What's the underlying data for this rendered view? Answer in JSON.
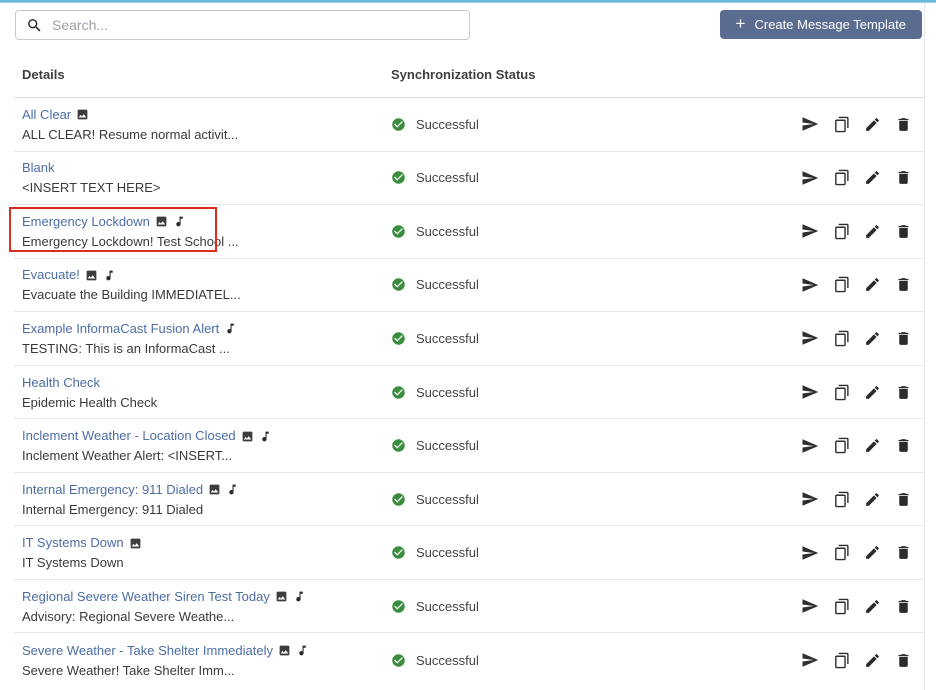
{
  "toolbar": {
    "search_placeholder": "Search...",
    "plus_glyph": "+",
    "create_button_label": "Create Message Template"
  },
  "table": {
    "headers": {
      "details": "Details",
      "status": "Synchronization Status"
    },
    "rows": [
      {
        "title": "All Clear",
        "icons": [
          "image"
        ],
        "subtitle": "ALL CLEAR! Resume normal activit...",
        "status": "Successful",
        "highlighted": false
      },
      {
        "title": "Blank",
        "icons": [],
        "subtitle": "<INSERT TEXT HERE>",
        "status": "Successful",
        "highlighted": false
      },
      {
        "title": "Emergency Lockdown",
        "icons": [
          "image",
          "audio"
        ],
        "subtitle": "Emergency Lockdown! Test School ...",
        "status": "Successful",
        "highlighted": true
      },
      {
        "title": "Evacuate!",
        "icons": [
          "image",
          "audio"
        ],
        "subtitle": "Evacuate the Building IMMEDIATEL...",
        "status": "Successful",
        "highlighted": false
      },
      {
        "title": "Example InformaCast Fusion Alert",
        "icons": [
          "audio"
        ],
        "subtitle": "TESTING: This is an InformaCast ...",
        "status": "Successful",
        "highlighted": false
      },
      {
        "title": "Health Check",
        "icons": [],
        "subtitle": "Epidemic Health Check",
        "status": "Successful",
        "highlighted": false
      },
      {
        "title": "Inclement Weather - Location Closed",
        "icons": [
          "image",
          "audio"
        ],
        "subtitle": "Inclement Weather Alert: <INSERT...",
        "status": "Successful",
        "highlighted": false
      },
      {
        "title": "Internal Emergency: 911 Dialed",
        "icons": [
          "image",
          "audio"
        ],
        "subtitle": "Internal Emergency: 911 Dialed",
        "status": "Successful",
        "highlighted": false
      },
      {
        "title": "IT Systems Down",
        "icons": [
          "image"
        ],
        "subtitle": "IT Systems Down",
        "status": "Successful",
        "highlighted": false
      },
      {
        "title": "Regional Severe Weather Siren Test Today",
        "icons": [
          "image",
          "audio"
        ],
        "subtitle": "Advisory: Regional Severe Weathe...",
        "status": "Successful",
        "highlighted": false
      },
      {
        "title": "Severe Weather - Take Shelter Immediately",
        "icons": [
          "image",
          "audio"
        ],
        "subtitle": "Severe Weather! Take Shelter Imm...",
        "status": "Successful",
        "highlighted": false
      }
    ]
  },
  "row_action_icons": [
    "send-icon",
    "copy-icon",
    "edit-icon",
    "delete-icon"
  ],
  "colors": {
    "accent_button": "#5a6c8f",
    "link_blue": "#4d6da4",
    "status_green": "#388e3c",
    "highlight_red": "#e02b20",
    "top_strip": "#74bcdf"
  }
}
